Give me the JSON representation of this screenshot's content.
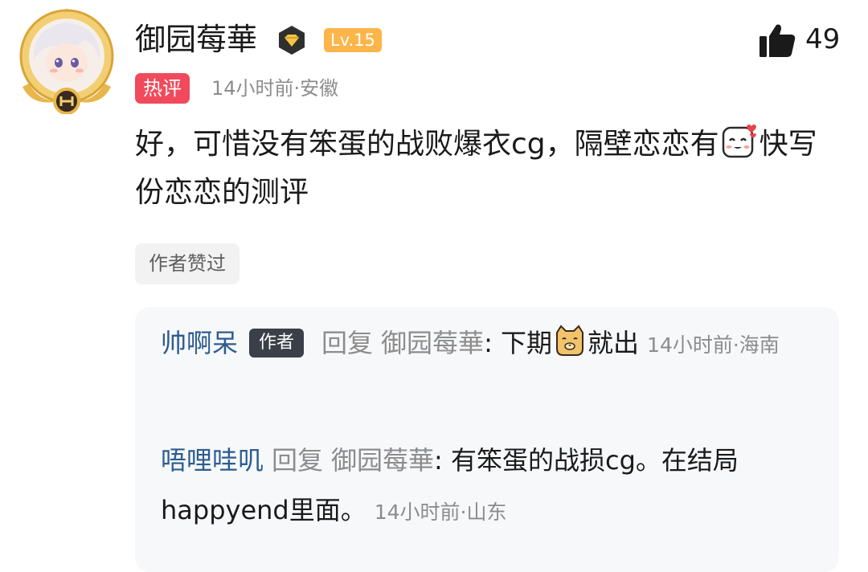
{
  "comment": {
    "username": "御园莓華",
    "level": "Lv.15",
    "like_count": "49",
    "hot_label": "热评",
    "time_location": "14小时前·安徽",
    "text_part1": "好，可惜没有笨蛋的战败爆衣cg，隔壁恋恋有",
    "text_part2": "快写份恋恋的测评",
    "author_liked_label": "作者赞过",
    "icons": [
      "avatar-frame",
      "verified-badge-icon",
      "thumbs-up-icon",
      "blush-emoji-icon"
    ]
  },
  "replies": [
    {
      "name": "帅啊呆",
      "tag": "作者",
      "reply_label": "回复",
      "target": "御园莓華",
      "text_before": ": 下期",
      "emoji": "cat-face-icon",
      "text_after": "就出",
      "time": "14小时前·海南"
    },
    {
      "name": "唔哩哇叽",
      "reply_label": "回复",
      "target": "御园莓華",
      "text": ": 有笨蛋的战损cg。在结局happyend里面。",
      "time": "14小时前·山东"
    }
  ],
  "colors": {
    "hot": "#f14a5c",
    "level": "#fdb54a",
    "reply_name": "#2c5c90",
    "meta": "#8c8c8c"
  }
}
